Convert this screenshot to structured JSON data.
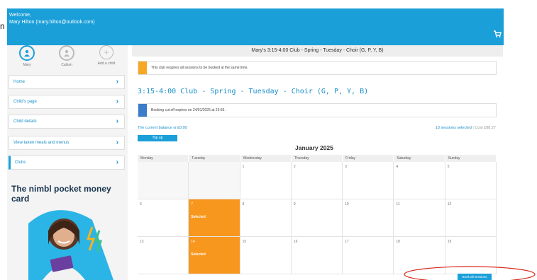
{
  "header": {
    "welcome": "Welcome,",
    "user": "Mary Hilton (mary.hilton@outlook.com)",
    "cut_letter": "n",
    "cart_icon": "cart-icon"
  },
  "children": [
    {
      "label": "Mary",
      "icon": "user-icon"
    },
    {
      "label": "Callum",
      "icon": "user-icon"
    },
    {
      "label": "Add a child",
      "icon": "plus-icon"
    }
  ],
  "nav": [
    {
      "label": "Home"
    },
    {
      "label": "Child's page"
    },
    {
      "label": "Child details"
    },
    {
      "label": "View taken meals and menus"
    },
    {
      "label": "Clubs"
    }
  ],
  "promo": {
    "title": "The nimbl pocket money card"
  },
  "main": {
    "title": "Mary's 3:15-4:00 Club - Spring - Tuesday - Choir (G, P, Y, B)",
    "notice_sessions": "This club requires all sessions to be booked at the same time.",
    "club_heading": "3:15-4:00 Club - Spring - Tuesday - Choir (G, P, Y, B)",
    "notice_cutoff": "Booking cut off expires on 24/01/2025 at 23:59.",
    "balance": "The current balance is £0.00",
    "topup": "Top up",
    "sessions_selected": "13 sessions selected",
    "cost": " | Cost £88.27",
    "month": "January 2025",
    "book_all": "Book all sessions"
  },
  "calendar": {
    "days": [
      "Monday",
      "Tuesday",
      "Wednesday",
      "Thursday",
      "Friday",
      "Saturday",
      "Sunday"
    ],
    "rows": [
      [
        "",
        "",
        "1",
        "2",
        "3",
        "4",
        "5"
      ],
      [
        "6",
        "7",
        "8",
        "9",
        "10",
        "11",
        "12"
      ],
      [
        "13",
        "14",
        "15",
        "16",
        "17",
        "18",
        "19"
      ]
    ],
    "selected_label": "Selected"
  },
  "colors": {
    "brand": "#1a9fd9",
    "selected": "#f7971e",
    "warning_bar": "#f7a823",
    "info_bar": "#3d7cc9",
    "highlight": "#d6281c"
  }
}
